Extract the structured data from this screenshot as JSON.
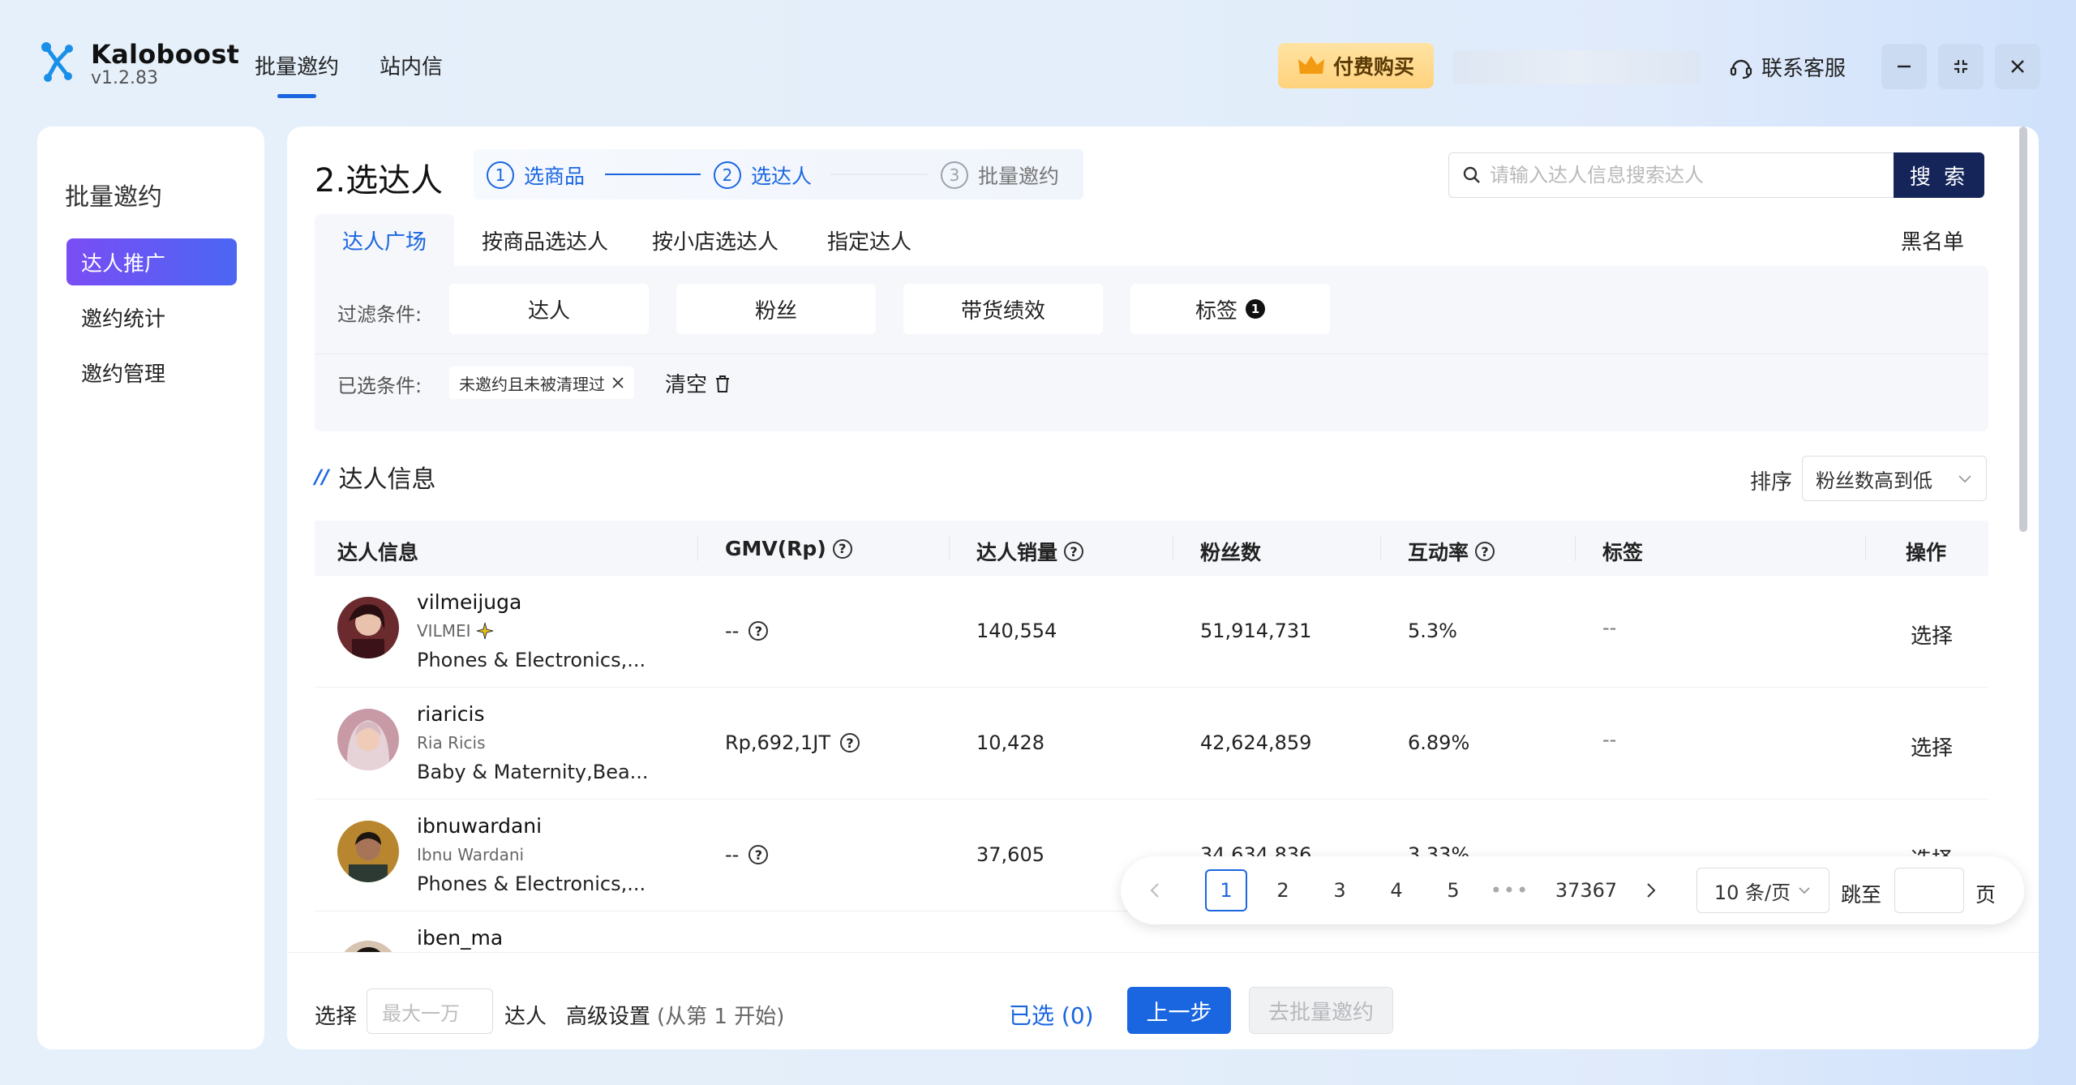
{
  "app": {
    "name": "Kaloboost",
    "version": "v1.2.83"
  },
  "topnav": {
    "tabs": [
      "批量邀约",
      "站内信"
    ],
    "active_index": 0
  },
  "header": {
    "pay_label": "付费购买",
    "service_label": "联系客服"
  },
  "sidebar": {
    "title": "批量邀约",
    "items": [
      {
        "label": "达人推广",
        "active": true
      },
      {
        "label": "邀约统计",
        "active": false
      },
      {
        "label": "邀约管理",
        "active": false
      }
    ]
  },
  "page": {
    "title": "2.选达人"
  },
  "steps": [
    {
      "num": "1",
      "label": "选商品",
      "state": "done"
    },
    {
      "num": "2",
      "label": "选达人",
      "state": "current"
    },
    {
      "num": "3",
      "label": "批量邀约",
      "state": "todo"
    }
  ],
  "search": {
    "placeholder": "请输入达人信息搜索达人",
    "button": "搜 索"
  },
  "subtabs": [
    "达人广场",
    "按商品选达人",
    "按小店选达人",
    "指定达人"
  ],
  "blacklist_label": "黑名单",
  "filters": {
    "label": "过滤条件:",
    "buttons": [
      {
        "label": "达人"
      },
      {
        "label": "粉丝"
      },
      {
        "label": "带货绩效"
      },
      {
        "label": "标签",
        "badge": "1"
      }
    ],
    "selected_label": "已选条件:",
    "selected_chip": "未邀约且未被清理过",
    "clear_label": "清空"
  },
  "section": {
    "title": "达人信息",
    "sort_label": "排序",
    "sort_value": "粉丝数高到低"
  },
  "table": {
    "headers": [
      "达人信息",
      "GMV(Rp)",
      "达人销量",
      "粉丝数",
      "互动率",
      "标签",
      "操作"
    ],
    "rows": [
      {
        "handle": "vilmeijuga",
        "nick": "VILMEI",
        "category": "Phones & Electronics,...",
        "gmv": "--",
        "sales": "140,554",
        "followers": "51,914,731",
        "engagement": "5.3%",
        "tags": "--",
        "action": "选择"
      },
      {
        "handle": "riaricis",
        "nick": "Ria Ricis",
        "category": "Baby & Maternity,Bea...",
        "gmv": "Rp,692,1JT",
        "sales": "10,428",
        "followers": "42,624,859",
        "engagement": "6.89%",
        "tags": "--",
        "action": "选择"
      },
      {
        "handle": "ibnuwardani",
        "nick": "Ibnu Wardani",
        "category": "Phones & Electronics,...",
        "gmv": "--",
        "sales": "37,605",
        "followers": "34,634,836",
        "engagement": "3.33%",
        "tags": "",
        "action": "选择"
      },
      {
        "handle": "iben_ma"
      }
    ]
  },
  "pagination": {
    "pages": [
      "1",
      "2",
      "3",
      "4",
      "5"
    ],
    "ellipsis": "•••",
    "last_page": "37367",
    "current": "1",
    "page_size": "10 条/页",
    "jump_label": "跳至",
    "page_suffix": "页"
  },
  "bottom": {
    "select_label": "选择",
    "max_placeholder": "最大一万",
    "unit_label": "达人",
    "advanced_label": "高级设置",
    "hint": "(从第 1 开始)",
    "selected_count": "已选 (0)",
    "prev_label": "上一步",
    "next_label": "去批量邀约"
  },
  "colors": {
    "accent": "#1a66e0",
    "search_button": "#15255a",
    "sidebar_active_start": "#7a4df5",
    "sidebar_active_end": "#4b66f2",
    "pay_button": "#ffd27d"
  }
}
